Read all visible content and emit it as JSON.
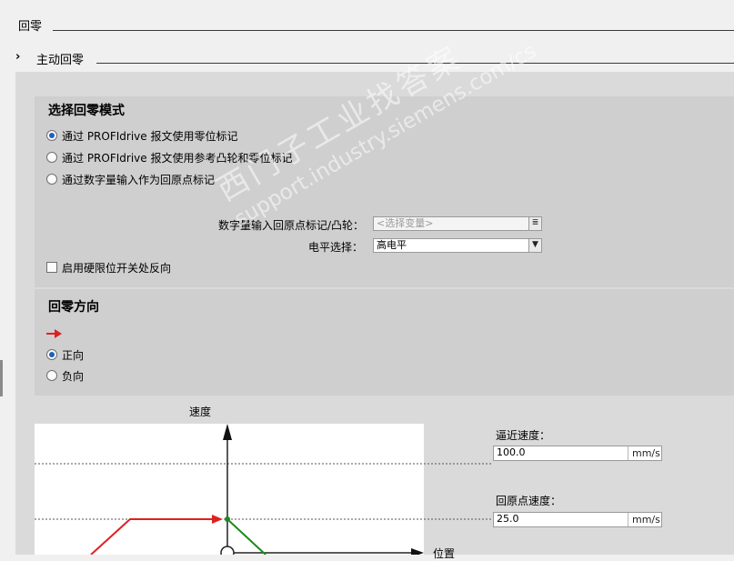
{
  "header": {
    "title": "回零"
  },
  "subheader": {
    "expand_glyph": "›",
    "title": "主动回零"
  },
  "mode_section": {
    "title": "选择回零模式",
    "options": [
      {
        "label": "通过 PROFIdrive 报文使用零位标记",
        "checked": true
      },
      {
        "label": "通过 PROFIdrive 报文使用参考凸轮和零位标记",
        "checked": false
      },
      {
        "label": "通过数字量输入作为回原点标记",
        "checked": false
      }
    ],
    "digital_input_label": "数字量输入回原点标记/凸轮：",
    "digital_input_placeholder": "<选择变量>",
    "level_label": "电平选择：",
    "level_value": "高电平",
    "reverse_checkbox_label": "启用硬限位开关处反向"
  },
  "direction_section": {
    "title": "回零方向",
    "options": [
      {
        "label": "正向",
        "checked": true
      },
      {
        "label": "负向",
        "checked": false
      }
    ]
  },
  "diagram": {
    "y_label": "速度",
    "x_label": "位置"
  },
  "approach_speed": {
    "label": "逼近速度：",
    "value": "100.0",
    "unit": "mm/s"
  },
  "homing_speed": {
    "label": "回原点速度：",
    "value": "25.0",
    "unit": "mm/s"
  },
  "watermark": {
    "line1": "西门子工业找答案",
    "line2": "support.industry.siemens.com/cs"
  },
  "colors": {
    "arrow_red": "#e02020",
    "curve_green": "#1a8a1a",
    "radio_blue": "#1f5fbf"
  }
}
